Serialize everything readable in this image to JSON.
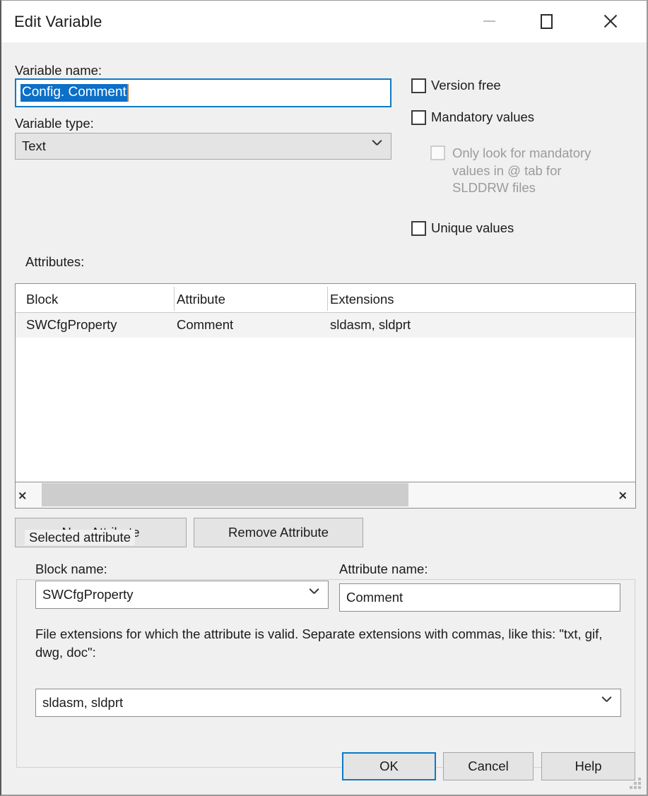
{
  "window": {
    "title": "Edit Variable",
    "controls": {
      "minimize": "Minimize",
      "maximize": "Maximize",
      "close": "Close"
    }
  },
  "form": {
    "variable_name_label": "Variable name:",
    "variable_name_value": "Config. Comment",
    "variable_type_label": "Variable type:",
    "variable_type_value": "Text"
  },
  "options": {
    "version_free": "Version free",
    "mandatory_values": "Mandatory values",
    "only_look_mandatory": "Only look for mandatory values in @ tab for SLDDRW files",
    "unique_values": "Unique values"
  },
  "attributes": {
    "label": "Attributes:",
    "columns": [
      "Block",
      "Attribute",
      "Extensions"
    ],
    "rows": [
      {
        "block": "SWCfgProperty",
        "attribute": "Comment",
        "extensions": "sldasm, sldprt"
      }
    ],
    "new_button": "New Attribute",
    "remove_button": "Remove Attribute"
  },
  "selected_attribute": {
    "group_title": "Selected attribute",
    "block_name_label": "Block name:",
    "block_name_value": "SWCfgProperty",
    "attribute_name_label": "Attribute name:",
    "attribute_name_value": "Comment",
    "extensions_help": "File extensions for which the attribute is valid. Separate extensions with commas, like this: \"txt, gif, dwg, doc\":",
    "extensions_value": "sldasm, sldprt"
  },
  "footer": {
    "ok": "OK",
    "cancel": "Cancel",
    "help": "Help"
  },
  "colors": {
    "accent": "#0d7ac4",
    "selection": "#0c6fc8",
    "dialog_bg": "#f0f0f0"
  }
}
